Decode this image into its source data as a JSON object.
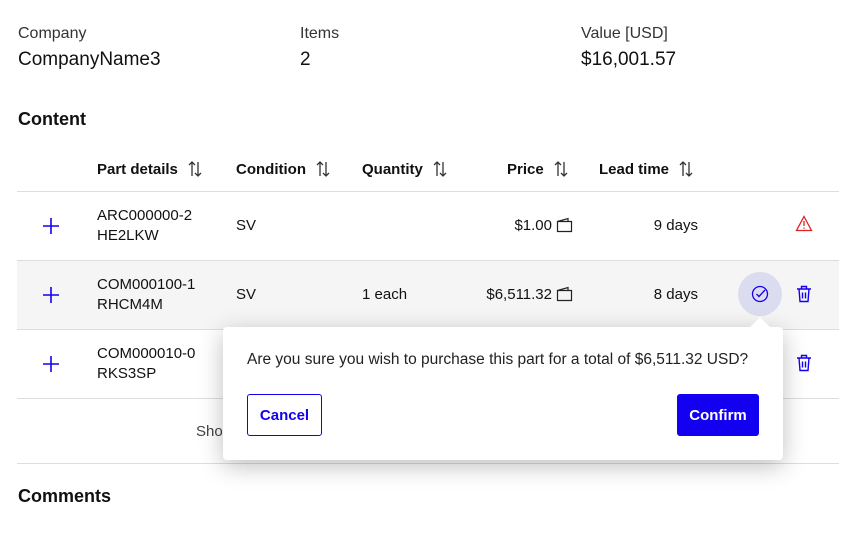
{
  "summary": [
    {
      "label": "Company",
      "value": "CompanyName3"
    },
    {
      "label": "Items",
      "value": "2"
    },
    {
      "label": "Value [USD]",
      "value": "$16,001.57"
    }
  ],
  "content_heading": "Content",
  "columns": [
    "Part details",
    "Condition",
    "Quantity",
    "Price",
    "Lead time"
  ],
  "rows": [
    {
      "part_line1": "ARC000000-2",
      "part_line2": "HE2LKW",
      "condition": "SV",
      "quantity": "",
      "price": "$1.00",
      "lead_time": "9 days",
      "status_icon": "warning-icon"
    },
    {
      "part_line1": "COM000100-1",
      "part_line2": "RHCM4M",
      "condition": "SV",
      "quantity": "1 each",
      "price": "$6,511.32",
      "lead_time": "8 days",
      "status_icon": "check-circle-icon"
    },
    {
      "part_line1": "COM000010-0",
      "part_line2": "RKS3SP",
      "condition": "",
      "quantity": "",
      "price": "",
      "lead_time": ""
    }
  ],
  "footer_partial": "Sho",
  "comments_heading": "Comments",
  "popover": {
    "message": "Are you sure you wish to purchase this part for a total of $6,511.32 USD?",
    "cancel": "Cancel",
    "confirm": "Confirm"
  },
  "colors": {
    "accent": "#1400f0",
    "warning": "#e02020",
    "row_highlight": "#f5f5f5",
    "check_bg": "#dcdcf0"
  }
}
